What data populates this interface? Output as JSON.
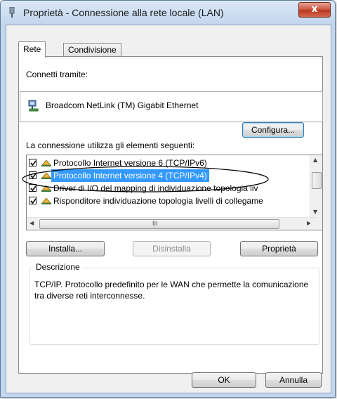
{
  "window": {
    "title": "Proprietà - Connessione alla rete locale (LAN)",
    "close_label": "x"
  },
  "tabs": [
    {
      "label": "Rete",
      "active": true
    },
    {
      "label": "Condivisione",
      "active": false
    }
  ],
  "connect_via": {
    "label": "Connetti tramite:",
    "adapter": "Broadcom NetLink (TM) Gigabit Ethernet",
    "configure_label": "Configura..."
  },
  "components": {
    "label": "La connessione utilizza gli elementi seguenti:",
    "items": [
      {
        "label": "Protocollo Internet versione 6 (TCP/IPv6)",
        "checked": true,
        "selected": false
      },
      {
        "label": "Protocollo Internet versione 4 (TCP/IPv4)",
        "checked": true,
        "selected": true
      },
      {
        "label": "Driver di I/O del mapping di individuazione topologia liv",
        "checked": true,
        "selected": false
      },
      {
        "label": "Risponditore individuazione topologia livelli di collegame",
        "checked": true,
        "selected": false
      }
    ],
    "hscroll_grip": "III"
  },
  "buttons": {
    "install": "Installa...",
    "uninstall": "Disinstalla",
    "properties": "Proprietà",
    "ok": "OK",
    "cancel": "Annulla"
  },
  "description": {
    "title": "Descrizione",
    "text": "TCP/IP. Protocollo predefinito per le WAN che permette la comunicazione tra diverse reti interconnesse."
  },
  "colors": {
    "selection": "#3399ff",
    "titlebar": "#c3d7ee",
    "close_button": "#c9523c"
  }
}
